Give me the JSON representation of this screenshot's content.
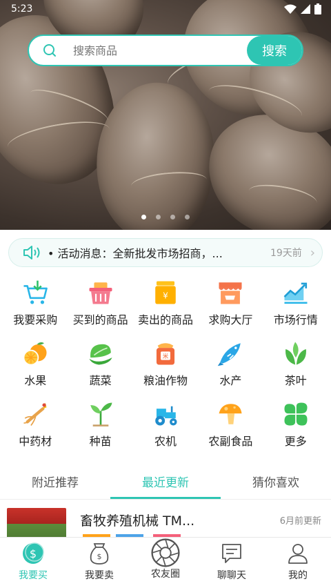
{
  "status_bar": {
    "time": "5:23"
  },
  "search": {
    "placeholder": "搜索商品",
    "button_label": "搜索"
  },
  "notice": {
    "text": "• 活动消息：全新批发市场招商，...",
    "time": "19天前"
  },
  "categories": [
    {
      "label": "我要采购",
      "icon": "cart-icon"
    },
    {
      "label": "买到的商品",
      "icon": "basket-icon"
    },
    {
      "label": "卖出的商品",
      "icon": "coin-box-icon"
    },
    {
      "label": "求购大厅",
      "icon": "shop-icon"
    },
    {
      "label": "市场行情",
      "icon": "trend-chart-icon"
    },
    {
      "label": "水果",
      "icon": "orange-icon"
    },
    {
      "label": "蔬菜",
      "icon": "vegetable-icon"
    },
    {
      "label": "粮油作物",
      "icon": "rice-bag-icon"
    },
    {
      "label": "水产",
      "icon": "fish-icon"
    },
    {
      "label": "茶叶",
      "icon": "tea-leaf-icon"
    },
    {
      "label": "中药材",
      "icon": "ginseng-icon"
    },
    {
      "label": "种苗",
      "icon": "seedling-icon"
    },
    {
      "label": "农机",
      "icon": "tractor-icon"
    },
    {
      "label": "农副食品",
      "icon": "mushroom-icon"
    },
    {
      "label": "更多",
      "icon": "clover-icon"
    }
  ],
  "tabs": [
    {
      "label": "附近推荐",
      "active": false
    },
    {
      "label": "最近更新",
      "active": true
    },
    {
      "label": "猜你喜欢",
      "active": false
    }
  ],
  "list": [
    {
      "title": "畜牧养殖机械 TM...",
      "time": "6月前更新"
    }
  ],
  "bottom_nav": [
    {
      "label": "我要买",
      "icon": "buy-icon",
      "active": true
    },
    {
      "label": "我要卖",
      "icon": "money-bag-icon",
      "active": false
    },
    {
      "label": "农友圈",
      "icon": "aperture-icon",
      "active": false
    },
    {
      "label": "聊聊天",
      "icon": "chat-icon",
      "active": false
    },
    {
      "label": "我的",
      "icon": "user-icon",
      "active": false
    }
  ],
  "colors": {
    "accent": "#2ec5b3"
  }
}
